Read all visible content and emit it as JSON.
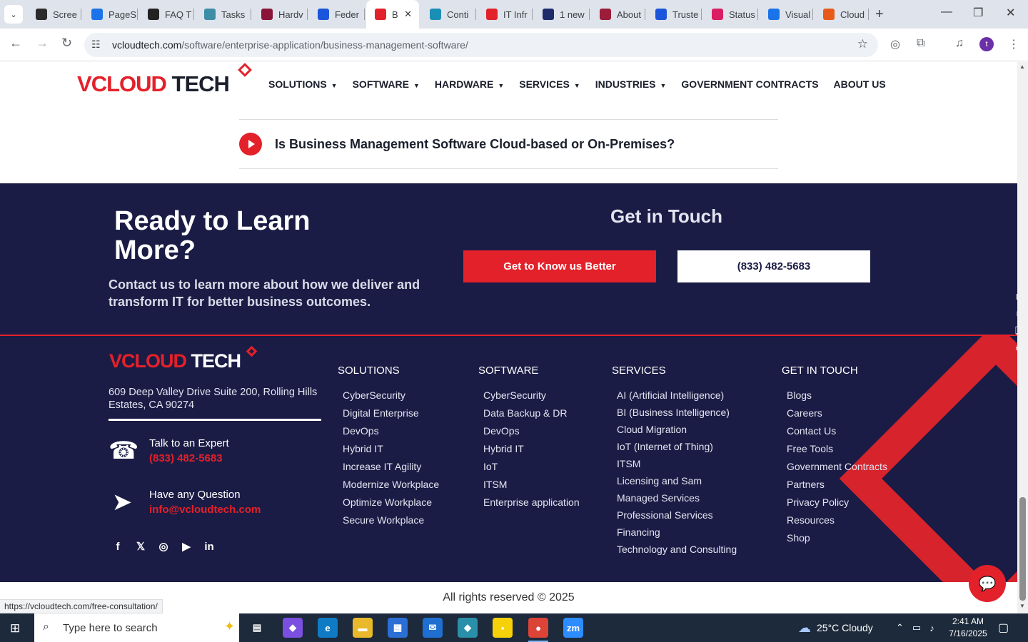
{
  "browser": {
    "tabs": [
      {
        "label": "Scree",
        "favicon": "screencast-icon",
        "color": "#2b2b2b"
      },
      {
        "label": "PageS",
        "favicon": "pagespeed-icon",
        "color": "#1a73e8"
      },
      {
        "label": "FAQ T",
        "favicon": "faq-icon",
        "color": "#222222"
      },
      {
        "label": "Tasks",
        "favicon": "tasks-icon",
        "color": "#3b8ea5"
      },
      {
        "label": "Hardv",
        "favicon": "v-icon",
        "color": "#8a1538"
      },
      {
        "label": "Feder",
        "favicon": "pen-icon",
        "color": "#1a56db"
      },
      {
        "label": "B",
        "favicon": "vcloud-icon",
        "color": "#e3212a",
        "active": true
      },
      {
        "label": "Conti",
        "favicon": "chat-icon",
        "color": "#1a8fb5"
      },
      {
        "label": "IT Infr",
        "favicon": "vcloud-icon",
        "color": "#e3212a"
      },
      {
        "label": "1 new",
        "favicon": "x-icon",
        "color": "#1d2b6b"
      },
      {
        "label": "About",
        "favicon": "swirl-icon",
        "color": "#9b1d3a"
      },
      {
        "label": "Truste",
        "favicon": "scales-icon",
        "color": "#1a56db"
      },
      {
        "label": "Status",
        "favicon": "feather-icon",
        "color": "#d91e63"
      },
      {
        "label": "Visual",
        "favicon": "pulse-icon",
        "color": "#1a73e8"
      },
      {
        "label": "Cloud",
        "favicon": "slash-icon",
        "color": "#e85a1a"
      }
    ],
    "url_domain": "vcloudtech.com",
    "url_path": "/software/enterprise-application/business-management-software/",
    "profile_initial": "t",
    "status_url": "https://vcloudtech.com/free-consultation/"
  },
  "site": {
    "logo": {
      "v": "V",
      "cloud": "CLOUD",
      "tech": "TECH"
    },
    "nav": [
      {
        "label": "SOLUTIONS",
        "dropdown": true
      },
      {
        "label": "SOFTWARE",
        "dropdown": true
      },
      {
        "label": "HARDWARE",
        "dropdown": true
      },
      {
        "label": "SERVICES",
        "dropdown": true
      },
      {
        "label": "INDUSTRIES",
        "dropdown": true
      },
      {
        "label": "GOVERNMENT CONTRACTS",
        "dropdown": false
      },
      {
        "label": "ABOUT US",
        "dropdown": false
      }
    ],
    "faq_question": "Is Business Management Software Cloud-based or On-Premises?"
  },
  "cta": {
    "title": "Ready to Learn More?",
    "text": "Contact us to learn more about how we deliver and transform IT for better business outcomes.",
    "get_in_touch": "Get in Touch",
    "primary_button": "Get to Know us Better",
    "phone_button": "(833) 482-5683"
  },
  "footer": {
    "address": "609 Deep Valley Drive Suite 200, Rolling Hills Estates, CA 90274",
    "expert_label": "Talk to an Expert",
    "expert_phone": "(833) 482-5683",
    "question_label": "Have any Question",
    "email": "info@vcloudtech.com",
    "social": [
      "facebook-icon",
      "x-twitter-icon",
      "instagram-icon",
      "youtube-icon",
      "linkedin-icon"
    ],
    "columns": {
      "solutions": {
        "title": "SOLUTIONS",
        "links": [
          "CyberSecurity",
          "Digital Enterprise",
          "DevOps",
          "Hybrid IT",
          "Increase IT Agility",
          "Modernize Workplace",
          "Optimize Workplace",
          "Secure Workplace"
        ]
      },
      "software": {
        "title": "SOFTWARE",
        "links": [
          "CyberSecurity",
          "Data Backup & DR",
          "DevOps",
          "Hybrid IT",
          "IoT",
          "ITSM",
          "Enterprise application"
        ]
      },
      "services": {
        "title": "SERVICES",
        "links": [
          "AI (Artificial Intelligence)",
          "BI (Business Intelligence)",
          "Cloud Migration",
          "IoT (Internet of Thing)",
          "ITSM",
          "Licensing and Sam",
          "Managed Services",
          "Professional Services",
          "Financing",
          "Technology and Consulting"
        ]
      },
      "get_in_touch": {
        "title": "GET IN TOUCH",
        "links": [
          "Blogs",
          "Careers",
          "Contact Us",
          "Free Tools",
          "Government Contracts",
          "Partners",
          "Privacy Policy",
          "Resources",
          "Shop"
        ]
      }
    },
    "copyright": "All rights reserved",
    "copyright_symbol": "©",
    "copyright_year": "2025"
  },
  "taskbar": {
    "search_placeholder": "Type here to search",
    "apps": [
      {
        "name": "task-view-icon",
        "glyph": "▤",
        "color": "transparent"
      },
      {
        "name": "copilot-icon",
        "glyph": "◆",
        "color": "#7b4fe0"
      },
      {
        "name": "edge-icon",
        "glyph": "e",
        "color": "#0f7bc4"
      },
      {
        "name": "file-explorer-icon",
        "glyph": "▬",
        "color": "#e8b92a"
      },
      {
        "name": "store-icon",
        "glyph": "▦",
        "color": "#2b6fd6"
      },
      {
        "name": "mail-icon",
        "glyph": "✉",
        "color": "#1f6fd1"
      },
      {
        "name": "app-diamond-icon",
        "glyph": "◆",
        "color": "#2a8fa8"
      },
      {
        "name": "sticky-notes-icon",
        "glyph": "▪",
        "color": "#f5d10a"
      },
      {
        "name": "chrome-icon",
        "glyph": "●",
        "color": "#db4437",
        "active": true
      },
      {
        "name": "zoom-icon",
        "glyph": "zm",
        "color": "#2d8cff"
      }
    ],
    "weather": "25°C  Cloudy",
    "time": "2:41 AM",
    "date": "7/16/2025"
  }
}
